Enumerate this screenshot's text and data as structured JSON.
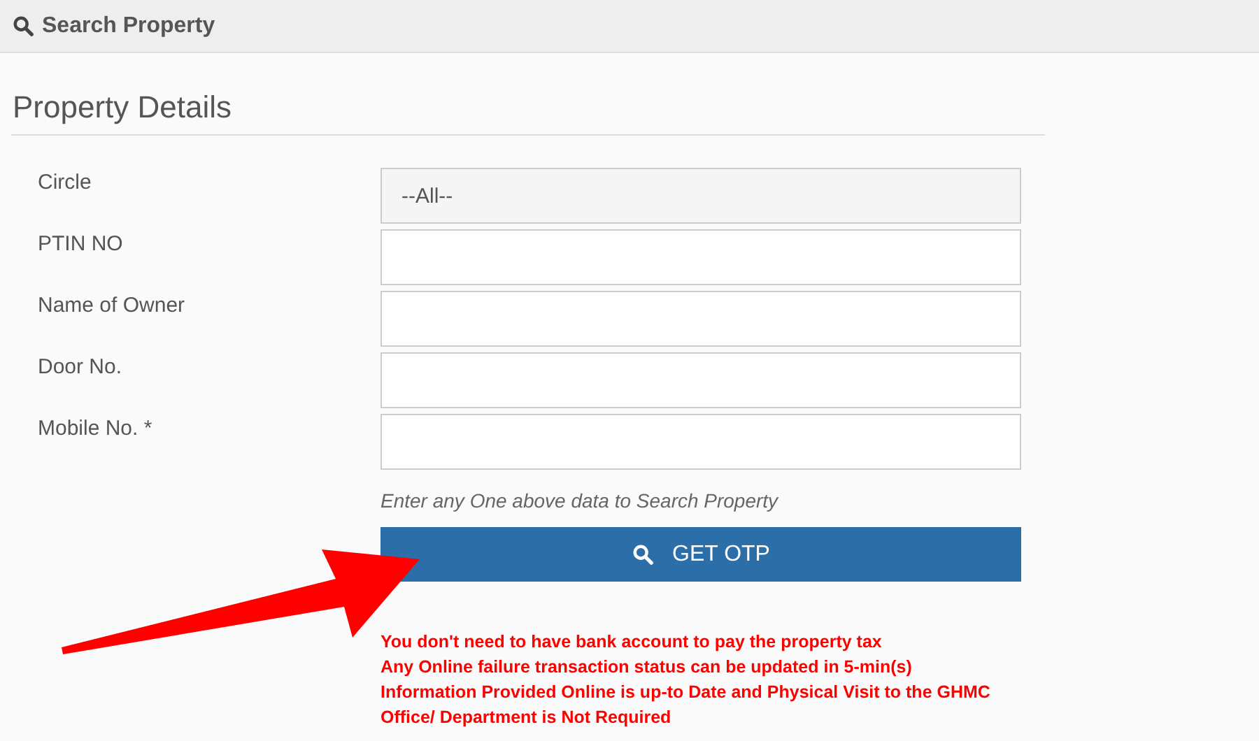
{
  "header": {
    "title": "Search Property"
  },
  "section": {
    "title": "Property Details"
  },
  "fields": [
    {
      "label": "Circle",
      "kind": "select",
      "value": "--All--"
    },
    {
      "label": "PTIN NO",
      "kind": "text"
    },
    {
      "label": "Name of Owner",
      "kind": "text"
    },
    {
      "label": "Door No.",
      "kind": "text"
    },
    {
      "label": "Mobile No. *",
      "kind": "text"
    }
  ],
  "hint": "Enter any One above data to Search Property",
  "button": {
    "label": "GET OTP"
  },
  "notes": [
    "You don't need to have bank account to pay the property tax",
    "Any Online failure transaction status can be updated in 5-min(s)",
    "Information Provided Online is up-to Date and Physical Visit to the GHMC Office/ Department is Not Required"
  ],
  "annotation": {
    "kind": "arrow"
  }
}
